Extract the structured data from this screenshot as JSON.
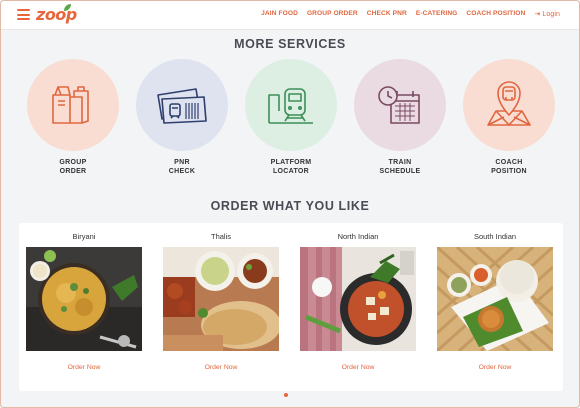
{
  "brand": {
    "logo_text": "zoop",
    "accent": "#e8663d"
  },
  "nav": {
    "items": [
      {
        "label": "JAIN FOOD"
      },
      {
        "label": "GROUP ORDER"
      },
      {
        "label": "CHECK PNR"
      },
      {
        "label": "E-CATERING"
      },
      {
        "label": "COACH POSITION"
      }
    ],
    "login_label": "Login"
  },
  "services_section": {
    "title": "MORE SERVICES",
    "items": [
      {
        "label": "GROUP\nORDER",
        "icon": "group-order-icon",
        "circle_color": "#f9ddd3"
      },
      {
        "label": "PNR\nCHECK",
        "icon": "pnr-ticket-icon",
        "circle_color": "#dfe3ef"
      },
      {
        "label": "PLATFORM\nLOCATOR",
        "icon": "platform-train-icon",
        "circle_color": "#dcefe2"
      },
      {
        "label": "TRAIN\nSCHEDULE",
        "icon": "train-schedule-icon",
        "circle_color": "#eadbe3"
      },
      {
        "label": "COACH\nPOSITION",
        "icon": "coach-position-icon",
        "circle_color": "#f9ddd3"
      }
    ]
  },
  "food_section": {
    "title": "ORDER WHAT YOU LIKE",
    "items": [
      {
        "name": "Biryani",
        "cta": "Order Now"
      },
      {
        "name": "Thalis",
        "cta": "Order Now"
      },
      {
        "name": "North Indian",
        "cta": "Order Now"
      },
      {
        "name": "South Indian",
        "cta": "Order Now"
      }
    ]
  }
}
